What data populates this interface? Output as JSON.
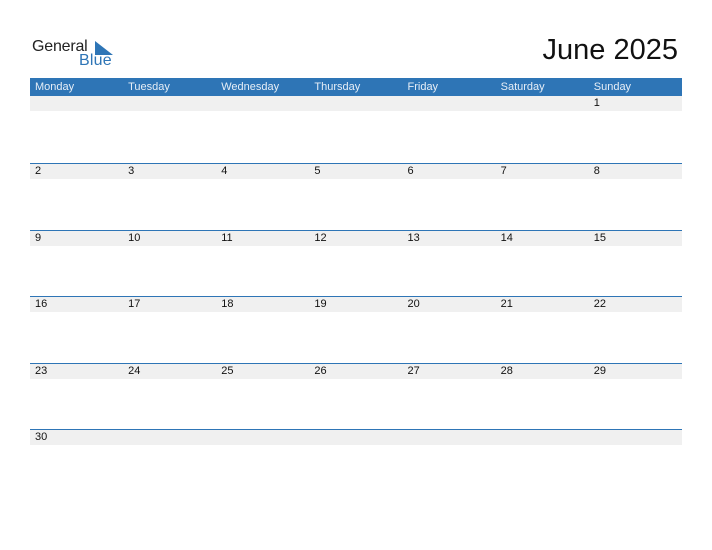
{
  "logo": {
    "line1": "General",
    "line2": "Blue"
  },
  "title": "June 2025",
  "weekdays": [
    "Monday",
    "Tuesday",
    "Wednesday",
    "Thursday",
    "Friday",
    "Saturday",
    "Sunday"
  ],
  "weeks": [
    [
      "",
      "",
      "",
      "",
      "",
      "",
      "1"
    ],
    [
      "2",
      "3",
      "4",
      "5",
      "6",
      "7",
      "8"
    ],
    [
      "9",
      "10",
      "11",
      "12",
      "13",
      "14",
      "15"
    ],
    [
      "16",
      "17",
      "18",
      "19",
      "20",
      "21",
      "22"
    ],
    [
      "23",
      "24",
      "25",
      "26",
      "27",
      "28",
      "29"
    ],
    [
      "30",
      "",
      "",
      "",
      "",
      "",
      ""
    ]
  ],
  "colors": {
    "accent": "#2e75b6",
    "day_row_bg": "#f0f0f0"
  }
}
